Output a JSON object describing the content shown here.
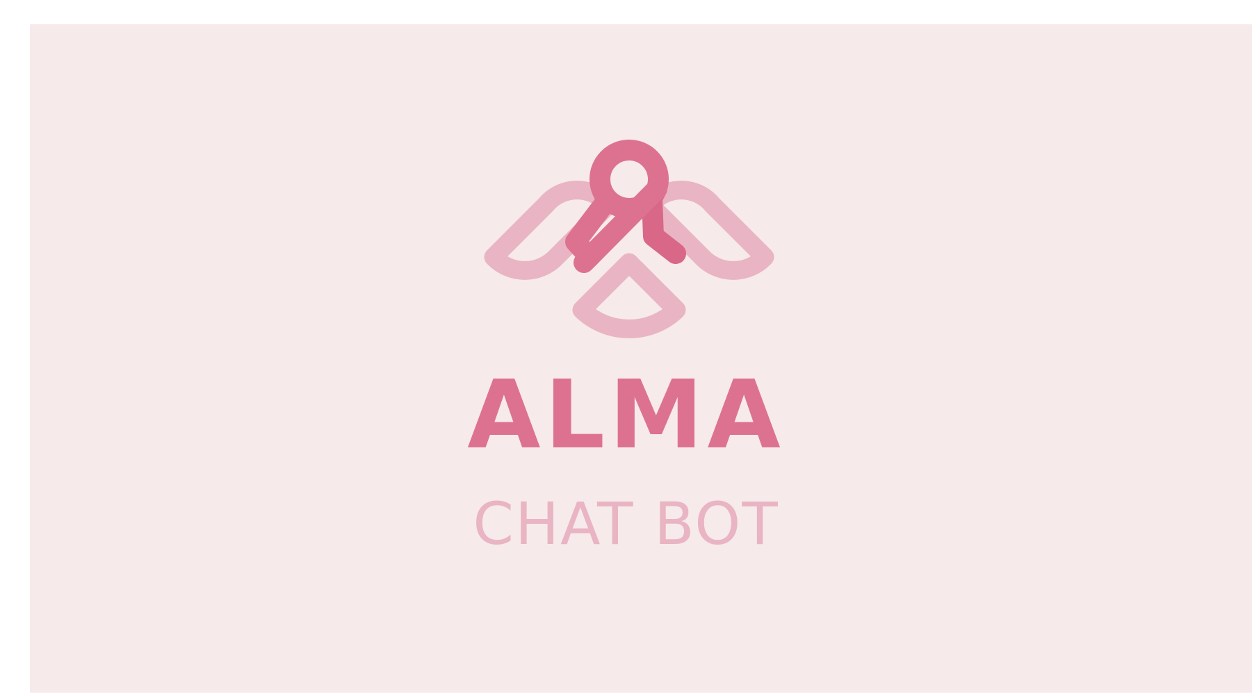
{
  "logo": {
    "icon": "angel-ribbon-icon",
    "name": "ALMA",
    "tagline": "CHAT BOT"
  },
  "colors": {
    "background": "#f6eaea",
    "primary": "#dd7290",
    "secondary": "#e9b4c3"
  }
}
